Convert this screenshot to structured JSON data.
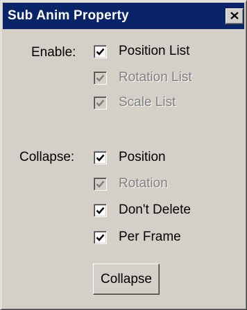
{
  "dialog": {
    "title": "Sub Anim Property",
    "close_icon": "close-icon"
  },
  "enable": {
    "label": "Enable:",
    "items": [
      {
        "label": "Position List",
        "checked": true,
        "enabled": true
      },
      {
        "label": "Rotation List",
        "checked": true,
        "enabled": false
      },
      {
        "label": "Scale List",
        "checked": true,
        "enabled": false
      }
    ]
  },
  "collapse": {
    "label": "Collapse:",
    "items": [
      {
        "label": "Position",
        "checked": true,
        "enabled": true
      },
      {
        "label": "Rotation",
        "checked": true,
        "enabled": false
      },
      {
        "label": "Don't Delete",
        "checked": true,
        "enabled": true
      },
      {
        "label": "Per Frame",
        "checked": true,
        "enabled": true
      }
    ],
    "button_label": "Collapse"
  },
  "colors": {
    "title_bar": "#0a246a",
    "window_face": "#d4d0c8",
    "disabled_text": "#808080"
  }
}
